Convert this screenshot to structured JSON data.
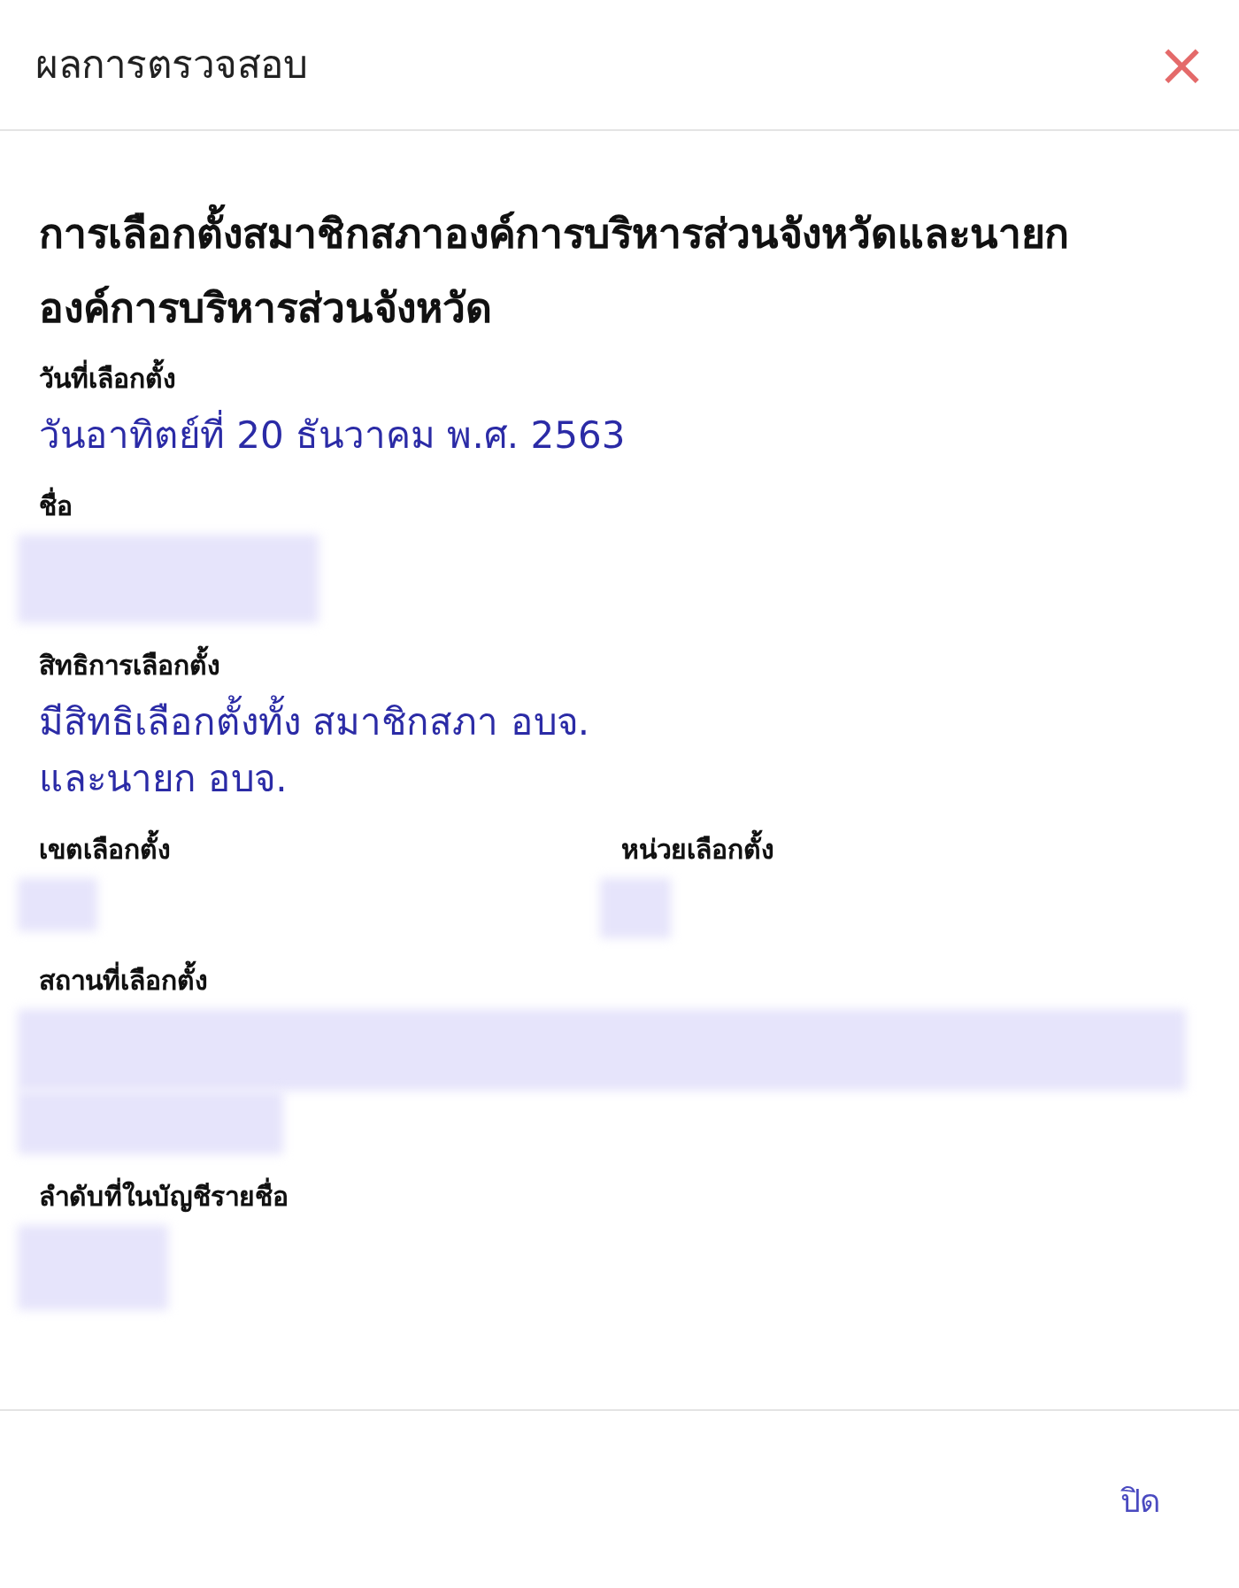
{
  "dialog": {
    "title": "ผลการตรวจสอบ",
    "close_icon": "×"
  },
  "heading": "การเลือกตั้งสมาชิกสภาองค์การบริหารส่วนจังหวัดและนายกองค์การบริหารส่วนจังหวัด",
  "rows": [
    {
      "fields": [
        {
          "label": "วันที่เลือกตั้ง",
          "kind": "text",
          "value": "วันอาทิตย์ที่ 20 ธันวาคม พ.ศ. 2563"
        }
      ]
    },
    {
      "fields": [
        {
          "label": "ชื่อ",
          "kind": "redacted"
        }
      ]
    },
    {
      "fields": [
        {
          "label": "สิทธิการเลือกตั้ง",
          "kind": "text",
          "value": "มีสิทธิเลือกตั้งทั้ง สมาชิกสภา อบจ. และนายก อบจ."
        }
      ]
    },
    {
      "fields": [
        {
          "label": "เขตเลือกตั้ง",
          "kind": "redacted"
        },
        {
          "label": "หน่วยเลือกตั้ง",
          "kind": "redacted"
        }
      ]
    },
    {
      "fields": [
        {
          "label": "สถานที่เลือกตั้ง",
          "kind": "redacted"
        }
      ]
    },
    {
      "fields": [
        {
          "label": "ลำดับที่ในบัญชีรายชื่อ",
          "kind": "redacted"
        }
      ]
    }
  ],
  "footer": {
    "close_button": "ปิด"
  }
}
